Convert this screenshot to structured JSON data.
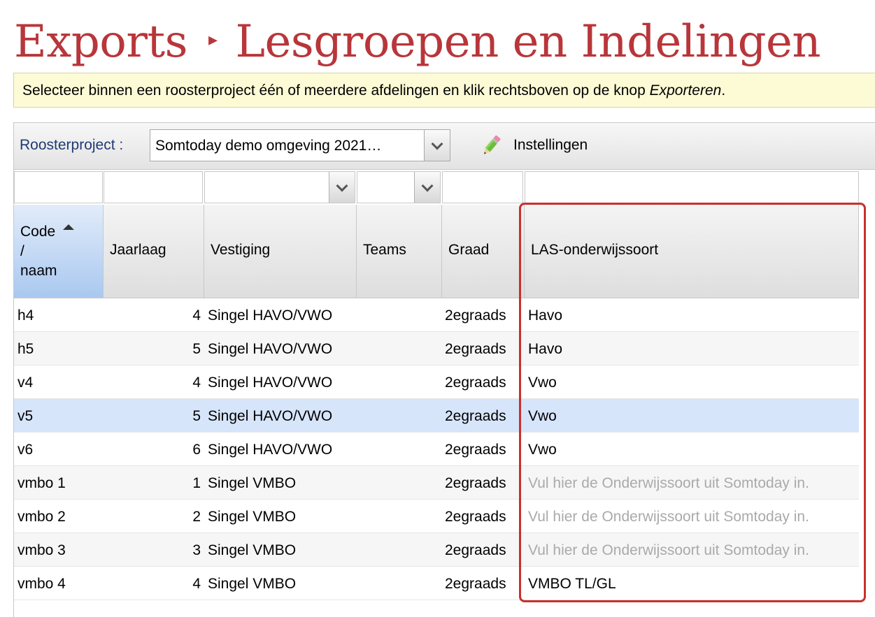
{
  "breadcrumb": {
    "root": "Exports",
    "separator": "▸",
    "current": "Lesgroepen en Indelingen"
  },
  "info": {
    "text_before": "Selecteer binnen een roosterproject één of meerdere afdelingen en klik rechtsboven op de knop ",
    "emphasis": "Exporteren",
    "text_after": "."
  },
  "toolbar": {
    "project_label": "Roosterproject :",
    "project_value": "Somtoday demo omgeving 2021…",
    "settings_label": "Instellingen",
    "settings_icon": "pencil-icon"
  },
  "columns": {
    "code": "Code / naam",
    "jaarlaag": "Jaarlaag",
    "vestiging": "Vestiging",
    "teams": "Teams",
    "graad": "Graad",
    "las": "LAS-onderwijssoort"
  },
  "rows": [
    {
      "code": "h4",
      "jaarlaag": "4",
      "vestiging": "Singel HAVO/VWO",
      "graad": "2egraads",
      "las": "Havo",
      "placeholder": false,
      "selected": false
    },
    {
      "code": "h5",
      "jaarlaag": "5",
      "vestiging": "Singel HAVO/VWO",
      "graad": "2egraads",
      "las": "Havo",
      "placeholder": false,
      "selected": false
    },
    {
      "code": "v4",
      "jaarlaag": "4",
      "vestiging": "Singel HAVO/VWO",
      "graad": "2egraads",
      "las": "Vwo",
      "placeholder": false,
      "selected": false
    },
    {
      "code": "v5",
      "jaarlaag": "5",
      "vestiging": "Singel HAVO/VWO",
      "graad": "2egraads",
      "las": "Vwo",
      "placeholder": false,
      "selected": true
    },
    {
      "code": "v6",
      "jaarlaag": "6",
      "vestiging": "Singel HAVO/VWO",
      "graad": "2egraads",
      "las": "Vwo",
      "placeholder": false,
      "selected": false
    },
    {
      "code": "vmbo 1",
      "jaarlaag": "1",
      "vestiging": "Singel VMBO",
      "graad": "2egraads",
      "las": "Vul hier de Onderwijssoort uit Somtoday in.",
      "placeholder": true,
      "selected": false
    },
    {
      "code": "vmbo 2",
      "jaarlaag": "2",
      "vestiging": "Singel VMBO",
      "graad": "2egraads",
      "las": "Vul hier de Onderwijssoort uit Somtoday in.",
      "placeholder": true,
      "selected": false
    },
    {
      "code": "vmbo 3",
      "jaarlaag": "3",
      "vestiging": "Singel VMBO",
      "graad": "2egraads",
      "las": "Vul hier de Onderwijssoort uit Somtoday in.",
      "placeholder": true,
      "selected": false
    },
    {
      "code": "vmbo 4",
      "jaarlaag": "4",
      "vestiging": "Singel VMBO",
      "graad": "2egraads",
      "las": "VMBO TL/GL",
      "placeholder": false,
      "selected": false
    }
  ],
  "colors": {
    "title": "#b8363a",
    "highlight": "#c9302c",
    "selected_row": "#d7e5fb",
    "placeholder_text": "#aaaaaa"
  }
}
